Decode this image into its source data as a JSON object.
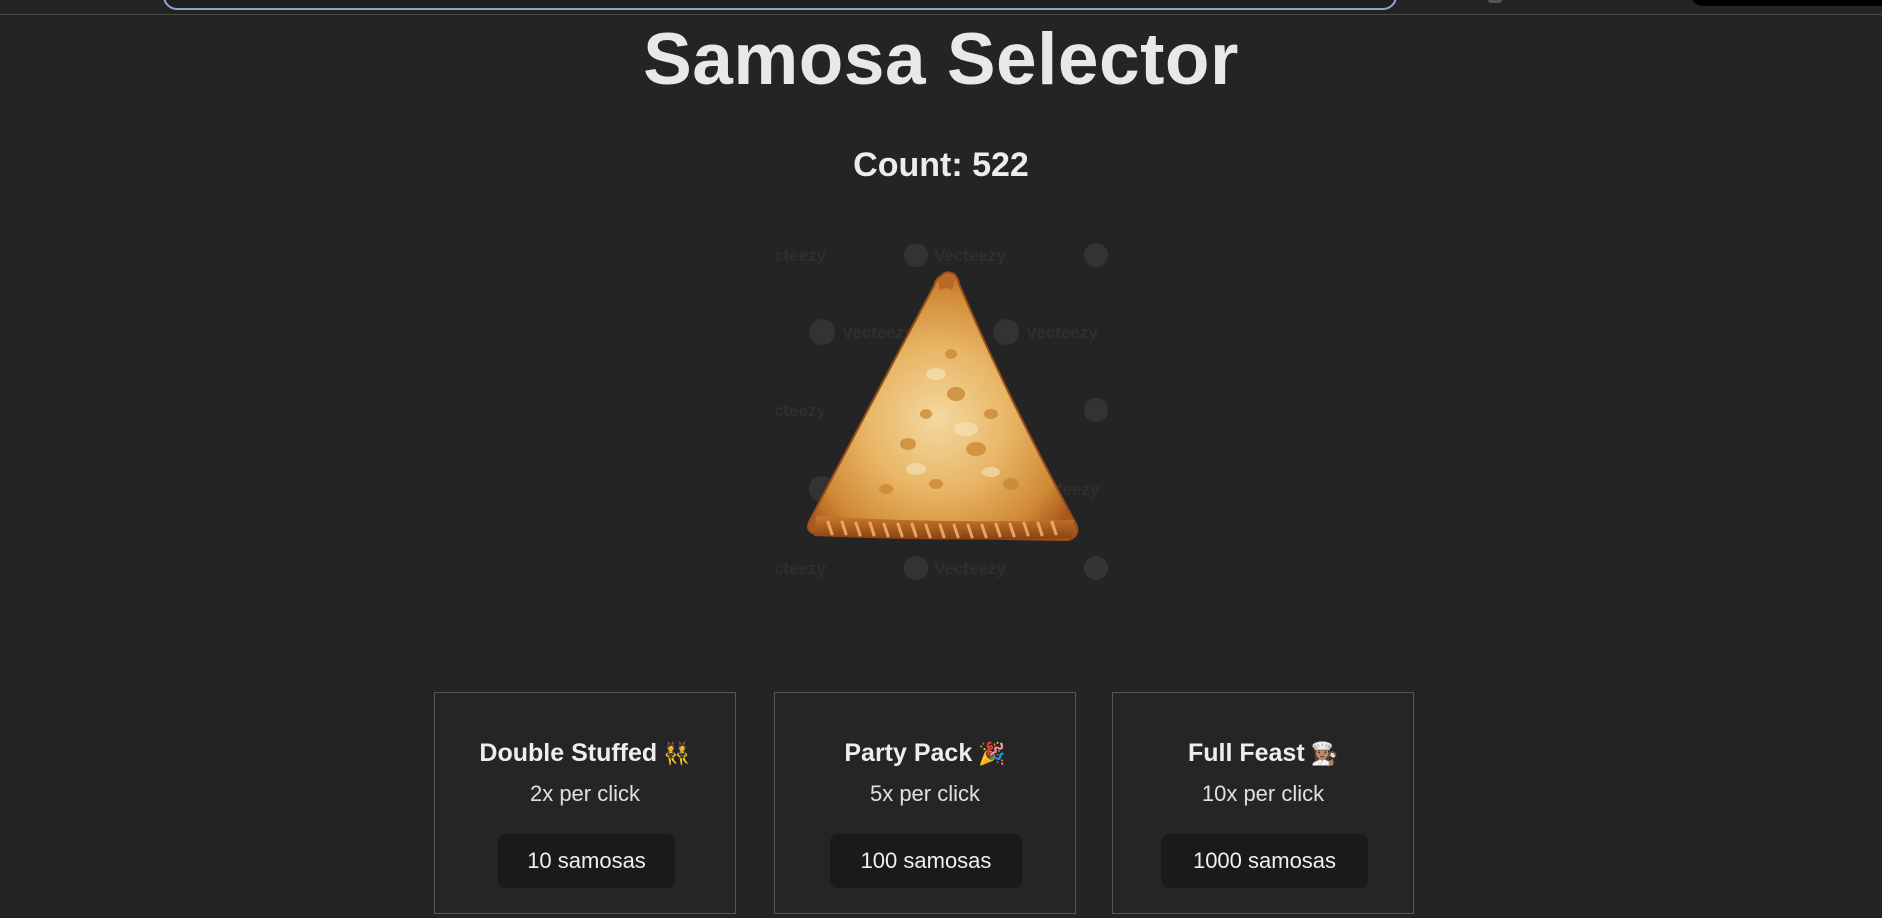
{
  "title": "Samosa Selector",
  "count_label": "Count: 522",
  "samosa_image": {
    "icon": "samosa-image",
    "watermark": "Vecteezy"
  },
  "upgrades": [
    {
      "name": "Double Stuffed",
      "emoji": "👯",
      "rate": "2x per click",
      "cost": "10 samosas"
    },
    {
      "name": "Party Pack",
      "emoji": "🎉",
      "rate": "5x per click",
      "cost": "100 samosas"
    },
    {
      "name": "Full Feast",
      "emoji": "👩🏽‍🍳",
      "rate": "10x per click",
      "cost": "1000 samosas"
    }
  ],
  "colors": {
    "background": "#242424",
    "card_border": "#575757",
    "button_bg": "#1a1a1a",
    "text": "#e8e8e8"
  }
}
